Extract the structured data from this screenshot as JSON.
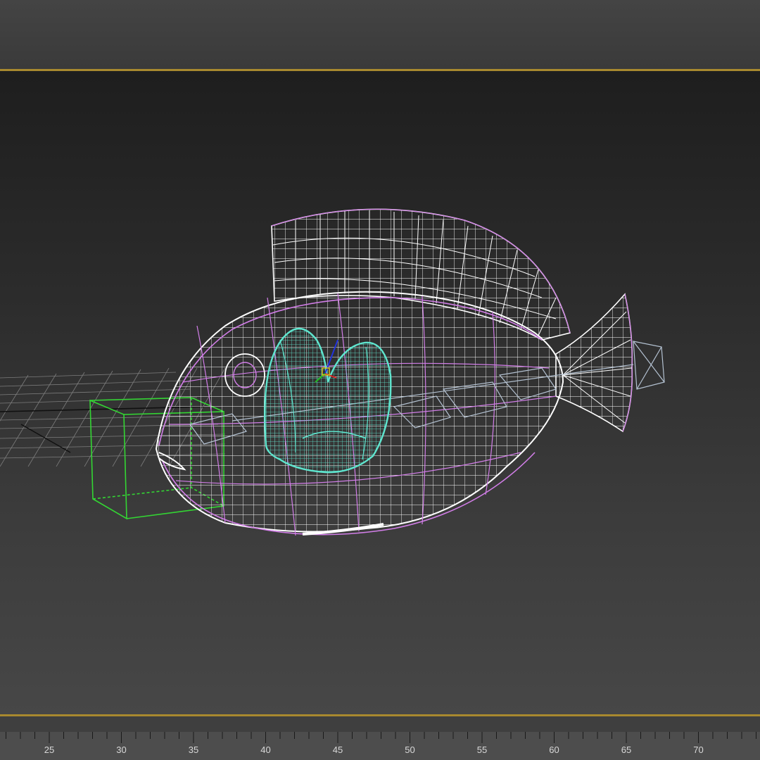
{
  "viewport": {
    "mode": "wireframe",
    "colors": {
      "background_top": "#1e1e1e",
      "background_bottom": "#474747",
      "active_border": "#a8892f",
      "grid": "#8a8a8a",
      "grid_axis": "#111111",
      "fish_mesh": "#ffffff",
      "fish_mesh_accent": "#d27ee8",
      "heart_mesh": "#5fe6cf",
      "helper_box": "#33d633",
      "skeleton": "#b4c2d2"
    },
    "objects": [
      "fish-body",
      "dorsal-fin",
      "tail-fin",
      "heart",
      "helper-box",
      "bone-chain",
      "home-grid"
    ]
  },
  "timeline": {
    "ticks": [
      "25",
      "30",
      "35",
      "40",
      "45",
      "50",
      "55",
      "60",
      "65",
      "70"
    ],
    "minor_per_major": 5
  }
}
